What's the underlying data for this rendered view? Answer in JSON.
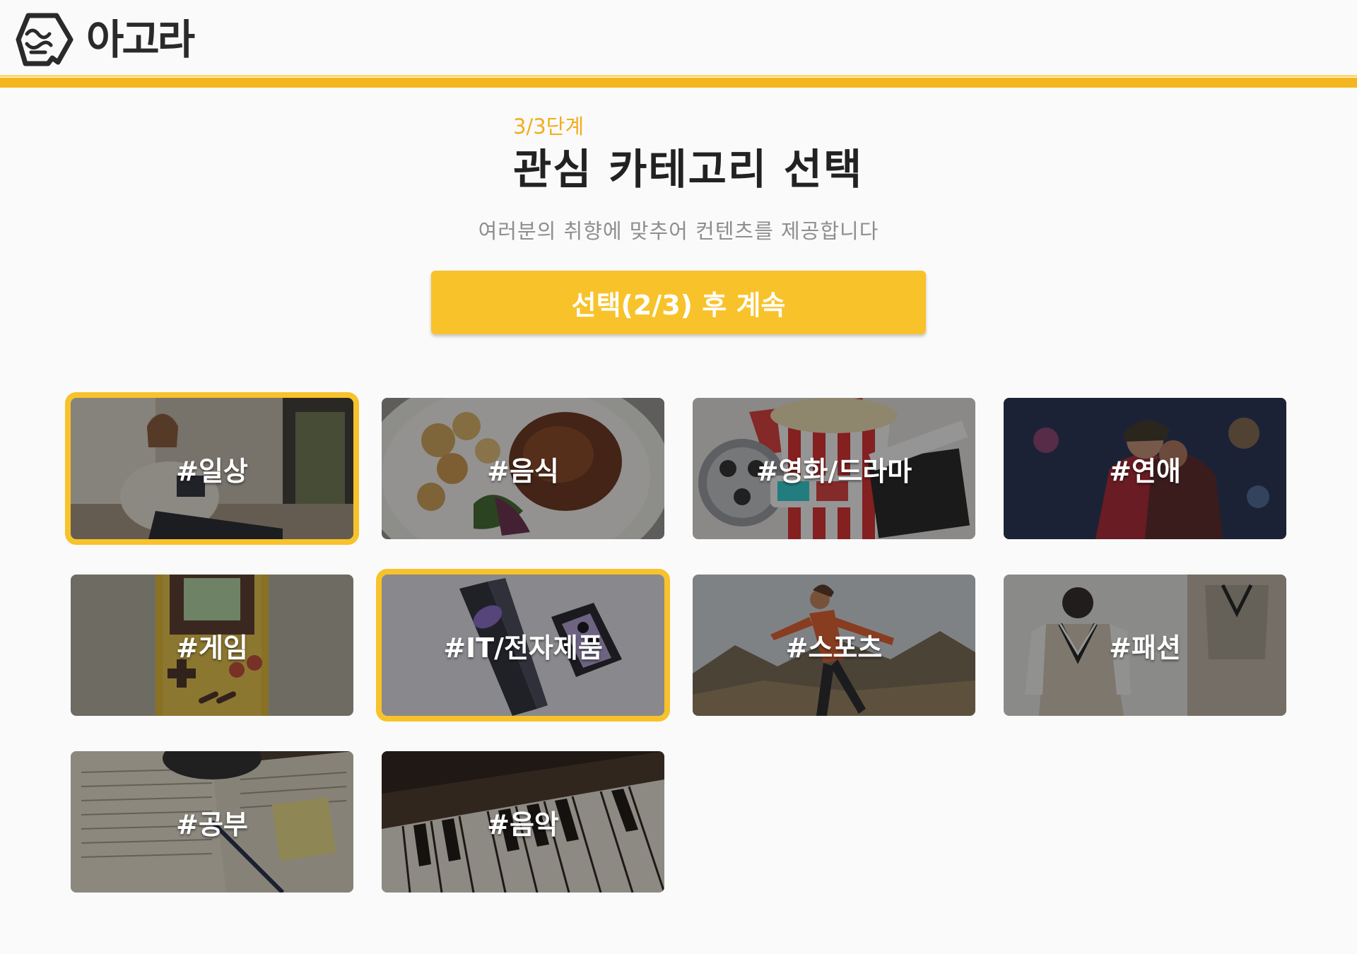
{
  "brand": {
    "name": "아고라",
    "accent": "#f8c22b",
    "bar": "#f5b521"
  },
  "onboarding": {
    "step": "3/3단계",
    "title": "관심 카테고리 선택",
    "subtitle": "여러분의 취향에 맞추어 컨텐츠를 제공합니다",
    "cta_label": "선택(2/3) 후 계속",
    "selected_count": 2,
    "max_select": 3
  },
  "categories": [
    {
      "label": "#일상",
      "selected": true,
      "image": "woman-reading-book"
    },
    {
      "label": "#음식",
      "selected": false,
      "image": "roast-chicken-plate"
    },
    {
      "label": "#영화/드라마",
      "selected": false,
      "image": "popcorn-clapperboard-3d-glasses"
    },
    {
      "label": "#연애",
      "selected": false,
      "image": "couple-hugging"
    },
    {
      "label": "#게임",
      "selected": false,
      "image": "handheld-game-console"
    },
    {
      "label": "#IT/전자제품",
      "selected": true,
      "image": "foldable-smartphones"
    },
    {
      "label": "#스포츠",
      "selected": false,
      "image": "woman-running-mountains"
    },
    {
      "label": "#패션",
      "selected": false,
      "image": "knit-vest-outfit"
    },
    {
      "label": "#공부",
      "selected": false,
      "image": "notebooks-and-pen"
    },
    {
      "label": "#음악",
      "selected": false,
      "image": "piano-keys"
    }
  ]
}
